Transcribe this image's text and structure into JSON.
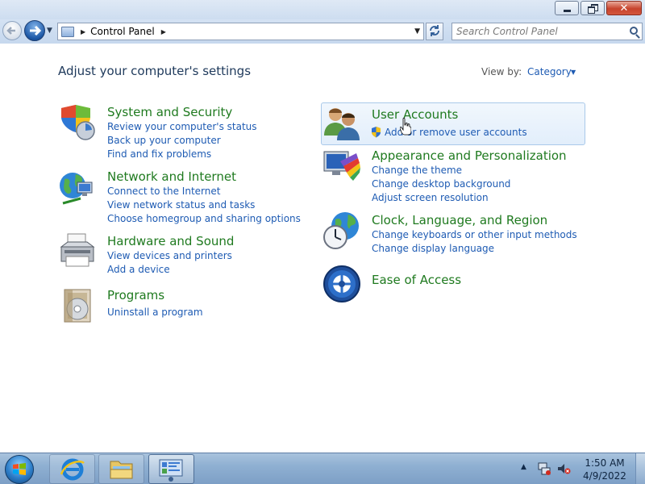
{
  "window": {
    "minimize_label": "minimize",
    "maximize_label": "restore",
    "close_label": "close"
  },
  "nav": {
    "breadcrumb": [
      "Control Panel"
    ],
    "search_placeholder": "Search Control Panel"
  },
  "main": {
    "heading": "Adjust your computer's settings",
    "view_by_label": "View by:",
    "view_by_value": "Category"
  },
  "categories_left": [
    {
      "title": "System and Security",
      "icon": "system-security-icon",
      "links": [
        "Review your computer's status",
        "Back up your computer",
        "Find and fix problems"
      ]
    },
    {
      "title": "Network and Internet",
      "icon": "network-globe-icon",
      "links": [
        "Connect to the Internet",
        "View network status and tasks",
        "Choose homegroup and sharing options"
      ]
    },
    {
      "title": "Hardware and Sound",
      "icon": "printer-icon",
      "links": [
        "View devices and printers",
        "Add a device"
      ]
    },
    {
      "title": "Programs",
      "icon": "programs-disc-icon",
      "links": [
        "Uninstall a program"
      ]
    }
  ],
  "categories_right": [
    {
      "title": "User Accounts",
      "icon": "users-icon",
      "links": [
        "Add or remove user accounts"
      ]
    },
    {
      "title": "Appearance and Personalization",
      "icon": "monitor-palette-icon",
      "links": [
        "Change the theme",
        "Change desktop background",
        "Adjust screen resolution"
      ]
    },
    {
      "title": "Clock, Language, and Region",
      "icon": "clock-globe-icon",
      "links": [
        "Change keyboards or other input methods",
        "Change display language"
      ]
    },
    {
      "title": "Ease of Access",
      "icon": "ease-of-access-icon",
      "links": []
    }
  ],
  "taskbar": {
    "apps": [
      "internet-explorer-icon",
      "windows-explorer-icon",
      "control-panel-icon"
    ],
    "time": "1:50 AM",
    "date": "4/9/2022"
  },
  "colors": {
    "title_green": "#1f7a1f",
    "link_blue": "#1e5bb3",
    "heading": "#1e395b",
    "taskbar": "#8fb0d2"
  }
}
